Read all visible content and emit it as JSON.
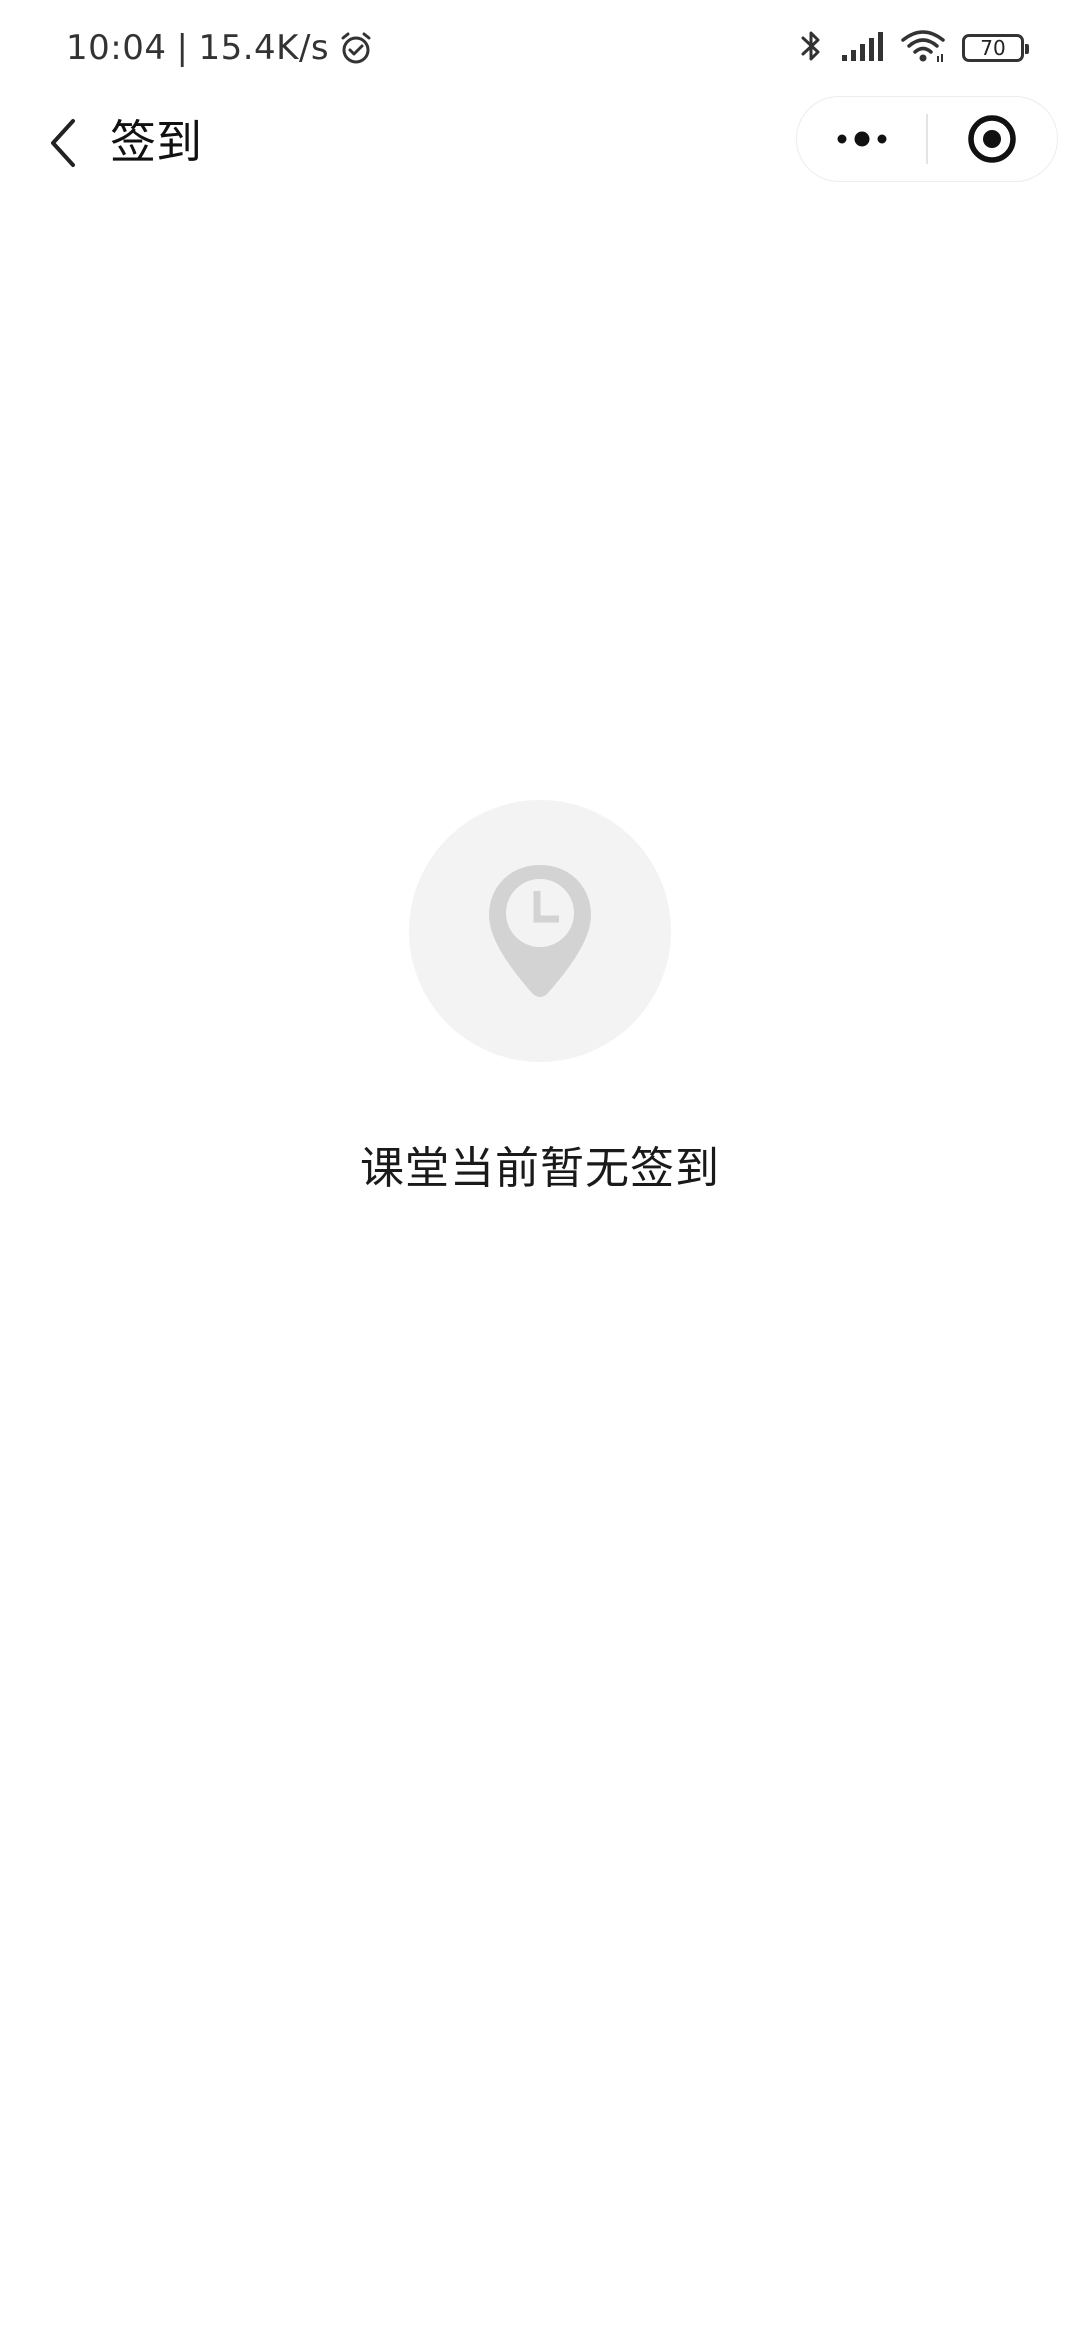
{
  "status_bar": {
    "time": "10:04",
    "separator": "|",
    "network_speed": "15.4K/s",
    "battery_level": "70",
    "icons": [
      "alarm-icon",
      "bluetooth-icon",
      "signal-icon",
      "wifi-icon",
      "battery-icon"
    ]
  },
  "nav": {
    "title": "签到",
    "back_icon": "chevron-left-icon",
    "capsule_icons": [
      "more-icon",
      "close-target-icon"
    ]
  },
  "empty_state": {
    "icon": "location-clock-icon",
    "message": "课堂当前暂无签到"
  },
  "colors": {
    "background": "#ffffff",
    "icon_circle": "#f3f3f3",
    "icon_gray": "#d3d3d3",
    "text": "#1a1a1a"
  }
}
